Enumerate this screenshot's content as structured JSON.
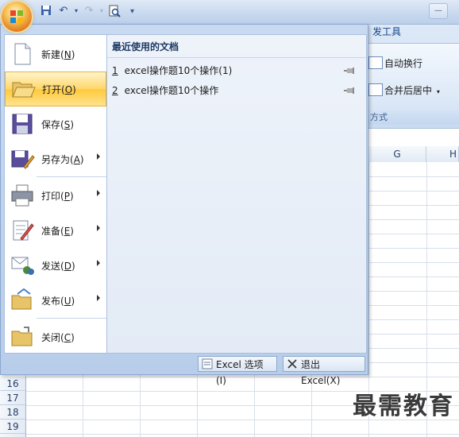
{
  "ribbon": {
    "tab_label": "发工具",
    "wrap_text": "自动换行",
    "merge_center": "合并后居中",
    "group_label": "方式"
  },
  "title_fragment": "",
  "columns": [
    "G",
    "H"
  ],
  "rows": [
    "16",
    "17",
    "18",
    "19"
  ],
  "menu": {
    "items": [
      {
        "label": "新建",
        "key": "N",
        "icon": "new-document-icon"
      },
      {
        "label": "打开",
        "key": "O",
        "icon": "open-folder-icon",
        "active": true
      },
      {
        "label": "保存",
        "key": "S",
        "icon": "save-disk-icon"
      },
      {
        "label": "另存为",
        "key": "A",
        "icon": "save-as-icon",
        "submenu": true
      },
      {
        "label": "打印",
        "key": "P",
        "icon": "printer-icon",
        "submenu": true
      },
      {
        "label": "准备",
        "key": "E",
        "icon": "prepare-icon",
        "submenu": true
      },
      {
        "label": "发送",
        "key": "D",
        "icon": "send-icon",
        "submenu": true
      },
      {
        "label": "发布",
        "key": "U",
        "icon": "publish-icon",
        "submenu": true
      },
      {
        "label": "关闭",
        "key": "C",
        "icon": "close-folder-icon"
      }
    ],
    "recent_title": "最近使用的文档",
    "recent": [
      {
        "num": "1",
        "name": "excel操作题10个操作(1)"
      },
      {
        "num": "2",
        "name": "excel操作题10个操作"
      }
    ],
    "options_button": "Excel 选项(I)",
    "exit_button": "退出 Excel(X)"
  },
  "watermark": "最需教育"
}
